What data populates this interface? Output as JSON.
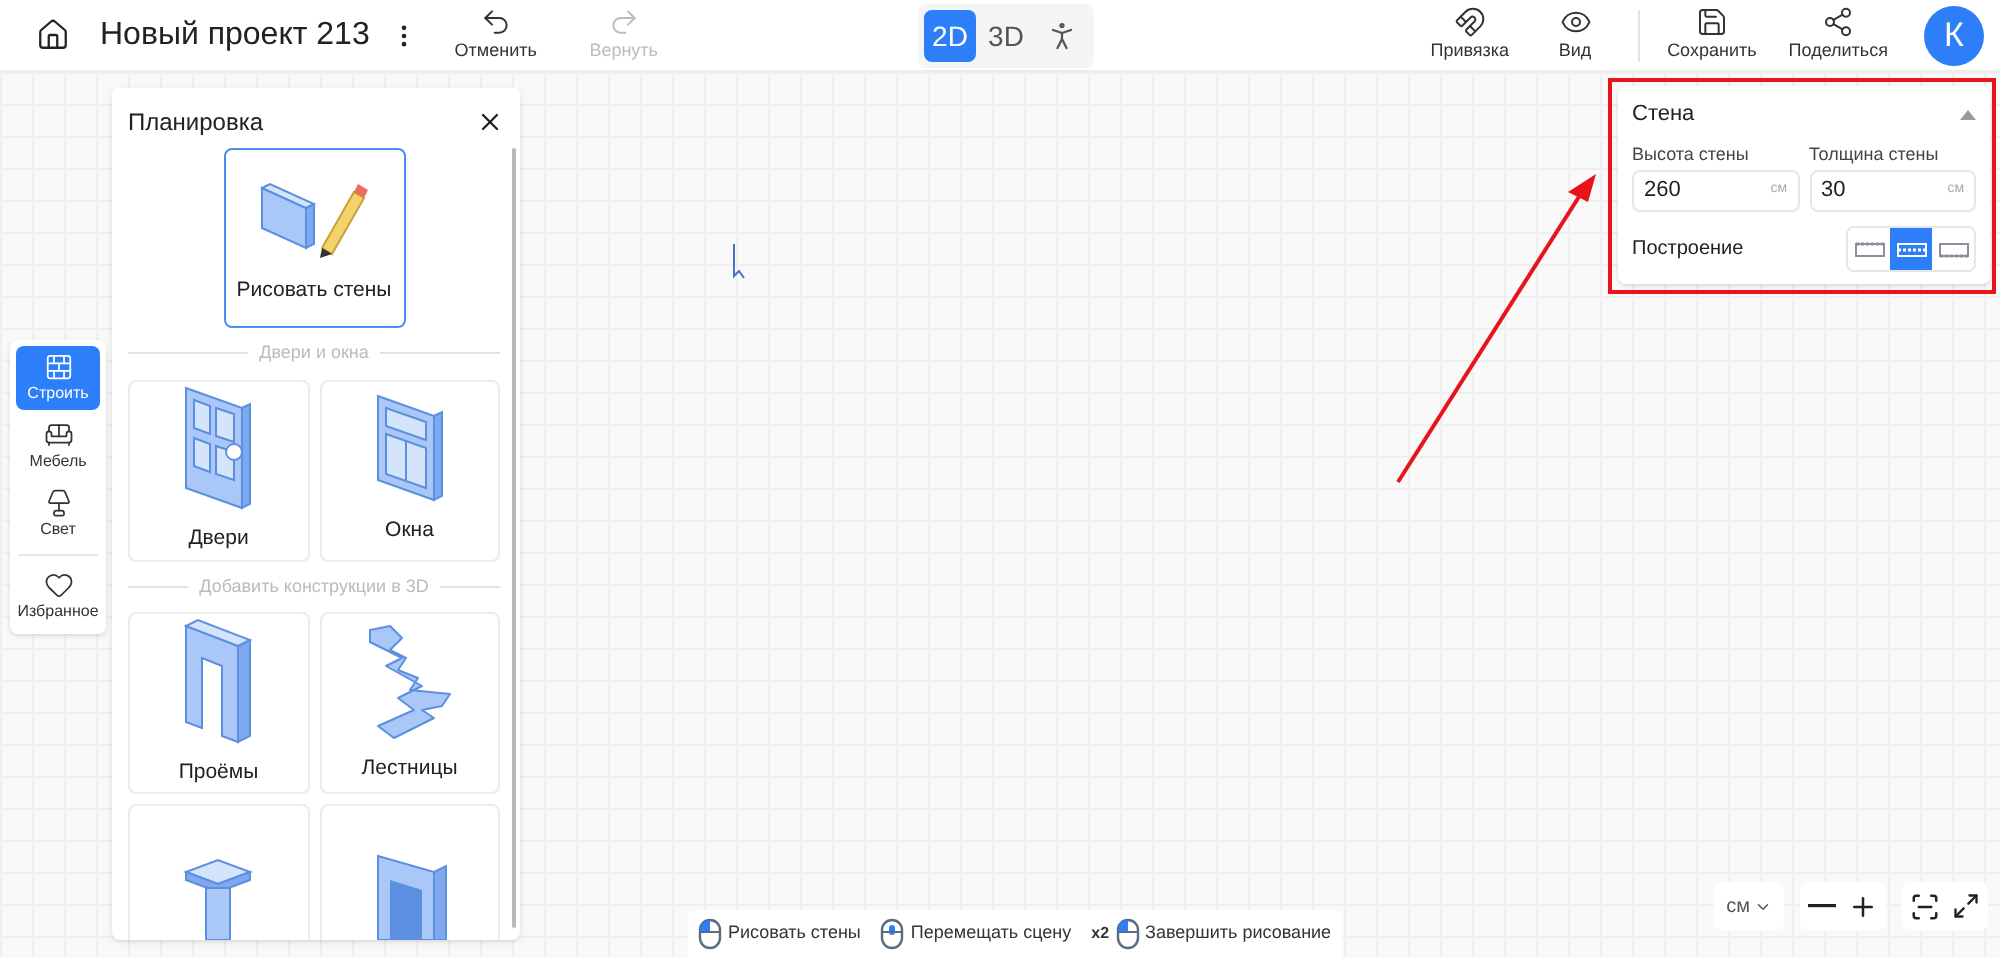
{
  "header": {
    "project_title": "Новый проект 213",
    "undo": {
      "label": "Отменить",
      "disabled": false
    },
    "redo": {
      "label": "Вернуть",
      "disabled": true
    },
    "view_modes": [
      {
        "kind": "plan",
        "label": "2D",
        "selected": true
      },
      {
        "kind": "spatial",
        "label": "3D",
        "selected": false
      },
      {
        "kind": "walk",
        "selected": false
      }
    ],
    "tools": [
      {
        "kind": "snap",
        "label": "Привязка"
      },
      {
        "kind": "view",
        "label": "Вид"
      },
      {
        "kind": "save",
        "label": "Сохранить"
      },
      {
        "kind": "share",
        "label": "Поделиться"
      }
    ],
    "avatar": "К"
  },
  "rail": [
    {
      "kind": "build",
      "label": "Строить",
      "selected": true
    },
    {
      "kind": "furniture",
      "label": "Мебель",
      "selected": false
    },
    {
      "kind": "light",
      "label": "Свет",
      "selected": false
    },
    {
      "kind": "favorites",
      "label": "Избранное",
      "selected": false
    }
  ],
  "layout_panel": {
    "title": "Планировка",
    "sections": [
      {
        "items": [
          {
            "kind": "wall",
            "label": "Рисовать стены",
            "selected": true
          }
        ]
      },
      {
        "heading": "Двери и окна",
        "items": [
          {
            "kind": "door",
            "label": "Двери",
            "selected": false
          },
          {
            "kind": "window",
            "label": "Окна",
            "selected": false
          }
        ]
      },
      {
        "heading": "Добавить конструкции в 3D",
        "items": [
          {
            "kind": "opening",
            "label": "Проёмы",
            "selected": false
          },
          {
            "kind": "stairs",
            "label": "Лестницы",
            "selected": false
          },
          {
            "kind": "column",
            "selected": false
          },
          {
            "kind": "niche",
            "selected": false
          }
        ]
      }
    ]
  },
  "wall_panel": {
    "title": "Стена",
    "fields": [
      {
        "label": "Высота стены",
        "value": "260",
        "unit": "см"
      },
      {
        "label": "Толщина стены",
        "value": "30",
        "unit": "см"
      }
    ],
    "construction": {
      "label": "Построение",
      "options": [
        {
          "kind": "inner",
          "selected": false
        },
        {
          "kind": "center",
          "selected": true
        },
        {
          "kind": "outer",
          "selected": false
        }
      ]
    }
  },
  "hints": [
    {
      "kind": "left",
      "label": "Рисовать стены"
    },
    {
      "kind": "middle",
      "label": "Перемещать сцену"
    },
    {
      "kind": "left",
      "prefix": "x2",
      "label": "Завершить рисование"
    }
  ],
  "units": "см"
}
